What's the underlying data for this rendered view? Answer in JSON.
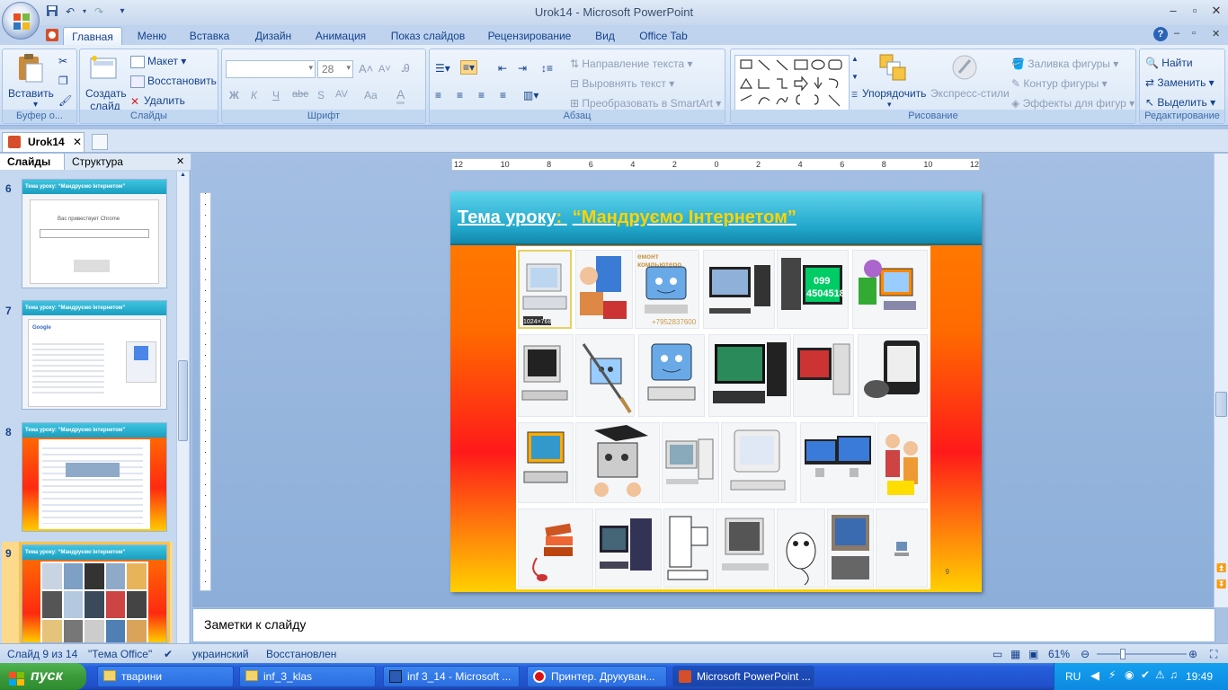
{
  "window": {
    "title": "Urok14  -  Microsoft PowerPoint",
    "controls": [
      "–",
      "▫",
      "✕"
    ]
  },
  "ribbon_tabs": [
    "Главная",
    "Меню",
    "Вставка",
    "Дизайн",
    "Анимация",
    "Показ слайдов",
    "Рецензирование",
    "Вид",
    "Office Tab"
  ],
  "ribbon": {
    "clipboard": {
      "paste": "Вставить",
      "label": "Буфер о..."
    },
    "slides": {
      "new_slide": "Создать слайд",
      "layout": "Макет",
      "reset": "Восстановить",
      "delete": "Удалить",
      "label": "Слайды"
    },
    "font": {
      "size": "28",
      "label": "Шрифт",
      "bold": "Ж",
      "italic": "К",
      "underline": "Ч",
      "strike": "abe",
      "shadow": "S",
      "spacing": "AV",
      "case": "Aa",
      "color": "A"
    },
    "paragraph": {
      "text_direction": "Направление текста",
      "align_text": "Выровнять текст",
      "smartart": "Преобразовать в SmartArt",
      "label": "Абзац"
    },
    "drawing": {
      "arrange": "Упорядочить",
      "quick_styles": "Экспресс-стили",
      "fill": "Заливка фигуры",
      "outline": "Контур фигуры",
      "effects": "Эффекты для фигур",
      "label": "Рисование"
    },
    "editing": {
      "find": "Найти",
      "replace": "Заменить",
      "select": "Выделить",
      "label": "Редактирование"
    }
  },
  "doc_tab": {
    "name": "Urok14"
  },
  "left_panel": {
    "tabs": [
      "Слайды",
      "Структура"
    ],
    "thumbnails": [
      {
        "num": "6",
        "title": "Тема уроку:  “Мандруємо  Інтернетом”",
        "caption": "Вас привествует Chrome"
      },
      {
        "num": "7",
        "title": "Тема уроку:  “Мандруємо  Інтернетом”",
        "caption": "Google"
      },
      {
        "num": "8",
        "title": "Тема уроку:  “Мандруємо  Інтернетом”",
        "caption": ""
      },
      {
        "num": "9",
        "title": "Тема уроку:  “Мандруємо  Інтернетом”",
        "caption": ""
      }
    ]
  },
  "ruler": {
    "h_ticks": [
      "12",
      "10",
      "8",
      "6",
      "4",
      "2",
      "0",
      "2",
      "4",
      "6",
      "8",
      "10",
      "12"
    ]
  },
  "slide": {
    "title_main": "Тема уроку",
    "title_colon": ":",
    "title_topic": "“Мандруємо Інтернетом”",
    "number": "9",
    "grid_texts": {
      "repair": "емонт компьютеро",
      "phone_top": "099",
      "phone_num": "4504518",
      "phone2": "+7952837600",
      "resolution": "1024×768"
    }
  },
  "notes": {
    "placeholder": "Заметки к слайду"
  },
  "status": {
    "slide_info": "Слайд 9 из 14",
    "theme": "\"Тема Office\"",
    "language": "украинский",
    "state": "Восстановлен",
    "zoom": "61%"
  },
  "taskbar": {
    "start": "пуск",
    "tasks": [
      "тварини",
      "inf_3_klas",
      "inf 3_14 - Microsoft ...",
      "Принтер. Друкуван...",
      "Microsoft PowerPoint ..."
    ],
    "lang": "RU",
    "time": "19:49"
  },
  "colors": {
    "ribbon_bg": "#d7e5f6",
    "slide_header": "#21a7cb",
    "taskbar": "#245edb",
    "start": "#3a9a3a"
  }
}
